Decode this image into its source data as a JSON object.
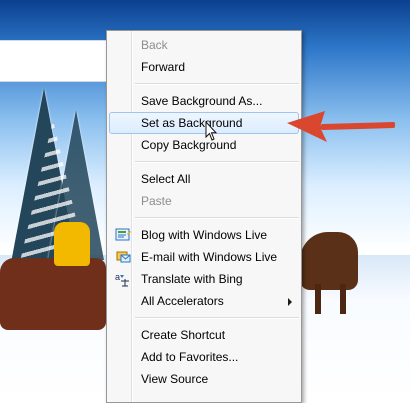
{
  "wallpaper": {
    "description": ""
  },
  "context_menu": {
    "items": [
      {
        "label": "Back",
        "disabled": true
      },
      {
        "label": "Forward",
        "disabled": false
      },
      {
        "label": "Save Background As...",
        "disabled": false
      },
      {
        "label": "Set as Background",
        "disabled": false,
        "highlighted": true
      },
      {
        "label": "Copy Background",
        "disabled": false
      },
      {
        "label": "Select All",
        "disabled": false
      },
      {
        "label": "Paste",
        "disabled": true
      },
      {
        "label": "Blog with Windows Live",
        "disabled": false,
        "icon": "blog-icon"
      },
      {
        "label": "E-mail with Windows Live",
        "disabled": false,
        "icon": "email-icon"
      },
      {
        "label": "Translate with Bing",
        "disabled": false,
        "icon": "translate-icon"
      },
      {
        "label": "All Accelerators",
        "disabled": false,
        "submenu": true
      },
      {
        "label": "Create Shortcut",
        "disabled": false
      },
      {
        "label": "Add to Favorites...",
        "disabled": false
      },
      {
        "label": "View Source",
        "disabled": false
      }
    ]
  },
  "colors": {
    "menu_background": "#f7f7f7",
    "highlight_border": "#9fc5ef",
    "arrow": "#d9472f"
  }
}
